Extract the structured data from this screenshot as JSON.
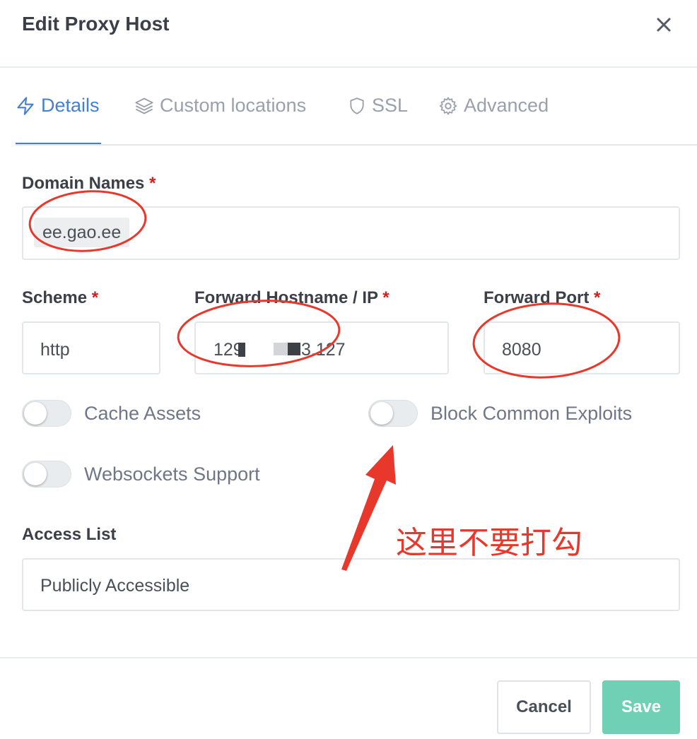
{
  "dialog": {
    "title": "Edit Proxy Host"
  },
  "icons": {
    "close": "close-icon",
    "details": "bolt-icon",
    "custom_locations": "layers-icon",
    "ssl": "shield-icon",
    "advanced": "gear-icon"
  },
  "tabs": [
    {
      "label": "Details",
      "active": true
    },
    {
      "label": "Custom locations",
      "active": false
    },
    {
      "label": "SSL",
      "active": false
    },
    {
      "label": "Advanced",
      "active": false
    }
  ],
  "form": {
    "domain_names": {
      "label": "Domain Names",
      "required_mark": "*",
      "value": "ee.gao.ee"
    },
    "scheme": {
      "label": "Scheme",
      "required_mark": "*",
      "value": "http"
    },
    "forward_host": {
      "label": "Forward Hostname / IP",
      "required_mark": "*",
      "value_start": "129",
      "value_end": "3.127"
    },
    "forward_port": {
      "label": "Forward Port",
      "required_mark": "*",
      "value": "8080"
    },
    "toggles": {
      "cache_assets": {
        "label": "Cache Assets",
        "on": false
      },
      "block_exploits": {
        "label": "Block Common Exploits",
        "on": false
      },
      "websockets": {
        "label": "Websockets Support",
        "on": false
      }
    },
    "access_list": {
      "label": "Access List",
      "value": "Publicly Accessible"
    }
  },
  "annotation": {
    "text": "这里不要打勾",
    "color": "#e8382c"
  },
  "footer": {
    "cancel_label": "Cancel",
    "save_label": "Save"
  },
  "colors": {
    "accent": "#467fcf",
    "save": "#6fd0b5",
    "required": "#cd201f",
    "annotation": "#e8382c"
  }
}
